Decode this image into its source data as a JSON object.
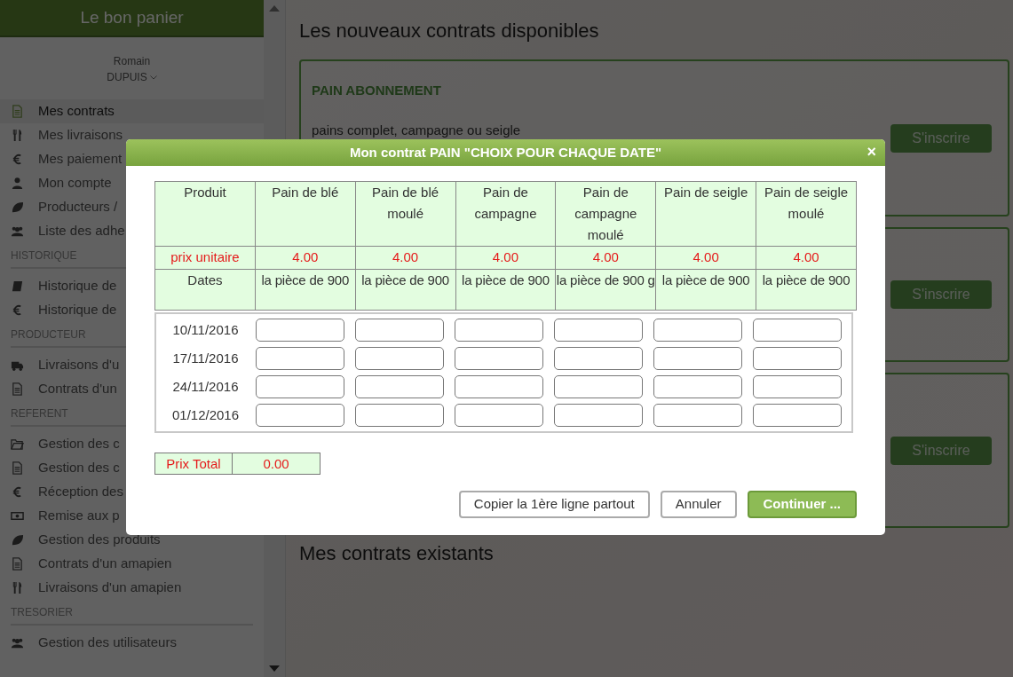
{
  "app": {
    "title": "Le bon panier"
  },
  "user": {
    "first_name": "Romain",
    "last_name": "DUPUIS"
  },
  "sidebar": {
    "items": [
      {
        "label": "Mes contrats",
        "selected": true
      },
      {
        "label": "Mes livraisons",
        "selected": false
      },
      {
        "label": "Mes paiement",
        "selected": false
      },
      {
        "label": "Mon compte",
        "selected": false
      },
      {
        "label": "Producteurs /",
        "selected": false
      },
      {
        "label": "Liste des adhe",
        "selected": false
      }
    ],
    "sections": [
      {
        "heading": "HISTORIQUE",
        "items": [
          {
            "label": "Historique de",
            "selected": false
          },
          {
            "label": "Historique de",
            "selected": false
          }
        ]
      },
      {
        "heading": "PRODUCTEUR",
        "items": [
          {
            "label": "Livraisons d'u",
            "selected": false
          },
          {
            "label": "Contrats d'un",
            "selected": false
          }
        ]
      },
      {
        "heading": "REFERENT",
        "items": [
          {
            "label": "Gestion des c",
            "selected": false
          },
          {
            "label": "Gestion des c",
            "selected": false
          },
          {
            "label": "Réception des",
            "selected": false
          },
          {
            "label": "Remise aux p",
            "selected": false
          },
          {
            "label": "Gestion des produits",
            "selected": false
          },
          {
            "label": "Contrats d'un amapien",
            "selected": false
          },
          {
            "label": "Livraisons d'un amapien",
            "selected": false
          }
        ]
      },
      {
        "heading": "TRESORIER",
        "items": [
          {
            "label": "Gestion des utilisateurs",
            "selected": false
          }
        ]
      }
    ]
  },
  "main": {
    "heading": "Les nouveaux contrats disponibles",
    "contracts": [
      {
        "title": "PAIN ABONNEMENT",
        "description": "pains complet, campagne ou seigle",
        "button": "S'inscrire"
      },
      {
        "button": "S'inscrire"
      },
      {
        "button": "S'inscrire"
      }
    ],
    "existing_heading": "Mes contrats existants"
  },
  "modal": {
    "title": "Mon contrat PAIN \"CHOIX POUR CHAQUE DATE\"",
    "close": "×",
    "columns": [
      "Produit",
      "Pain de blé",
      "Pain de blé moulé",
      "Pain de campagne",
      "Pain de campagne moulé",
      "Pain de seigle",
      "Pain de seigle moulé"
    ],
    "price_label": "prix unitaire",
    "prices": [
      "4.00",
      "4.00",
      "4.00",
      "4.00",
      "4.00",
      "4.00"
    ],
    "unit_label": "Dates",
    "units": [
      "la pièce de 900",
      "la pièce de 900",
      "la pièce de 900",
      "la pièce de 900 g",
      "la pièce de 900",
      "la pièce de 900"
    ],
    "dates": [
      "10/11/2016",
      "17/11/2016",
      "24/11/2016",
      "01/12/2016"
    ],
    "total_label": "Prix Total",
    "total": "0.00",
    "buttons": [
      {
        "label": "Copier la 1ère ligne partout",
        "kind": "secondary"
      },
      {
        "label": "Annuler",
        "kind": "secondary"
      },
      {
        "label": "Continuer ...",
        "kind": "primary"
      }
    ]
  }
}
